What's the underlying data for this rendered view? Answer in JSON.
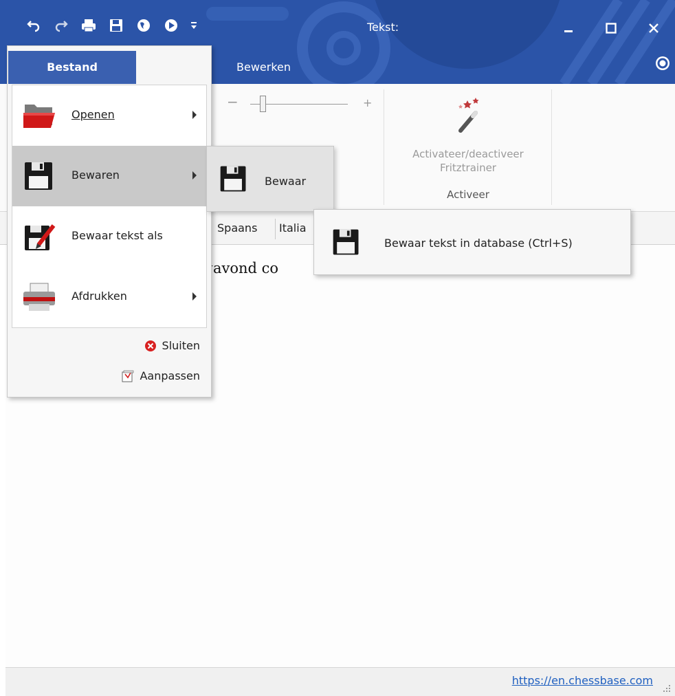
{
  "window": {
    "title": "Tekst:"
  },
  "quick_access": [
    "undo-icon",
    "redo-icon",
    "print-icon",
    "save-icon",
    "globe-icon",
    "globe-arrow-icon",
    "customize-dropdown-icon"
  ],
  "ribbon": {
    "tab_bewerken": "Bewerken",
    "zoom_minus": "−",
    "zoom_plus": "+",
    "fritz_button_label": "Activateer/deactiveer\nFritztrainer",
    "group_label": "Activeer"
  },
  "language_tabs": [
    "Spaans",
    "Italia"
  ],
  "editor": {
    "visible_text": "agavond co"
  },
  "file_menu": {
    "tab_label": "Bestand",
    "items": [
      {
        "label": "Openen",
        "icon": "folder-icon",
        "submenu": true
      },
      {
        "label": "Bewaren",
        "icon": "floppy-disk-icon",
        "submenu": true
      },
      {
        "label": "Bewaar tekst als",
        "icon": "save-as-icon",
        "submenu": false
      },
      {
        "label": "Afdrukken",
        "icon": "printer-icon",
        "submenu": true
      }
    ],
    "close_label": "Sluiten",
    "customize_label": "Aanpassen"
  },
  "submenu_bewaren": {
    "label": "Bewaar"
  },
  "submenu_bewaar": {
    "label": "Bewaar tekst in database (Ctrl+S)"
  },
  "statusbar": {
    "link": "https://en.chessbase.com"
  },
  "colors": {
    "titlebar": "#2b54a8",
    "file_tab": "#3a60b0",
    "hover": "#c9c9c9",
    "link": "#2060c0"
  }
}
